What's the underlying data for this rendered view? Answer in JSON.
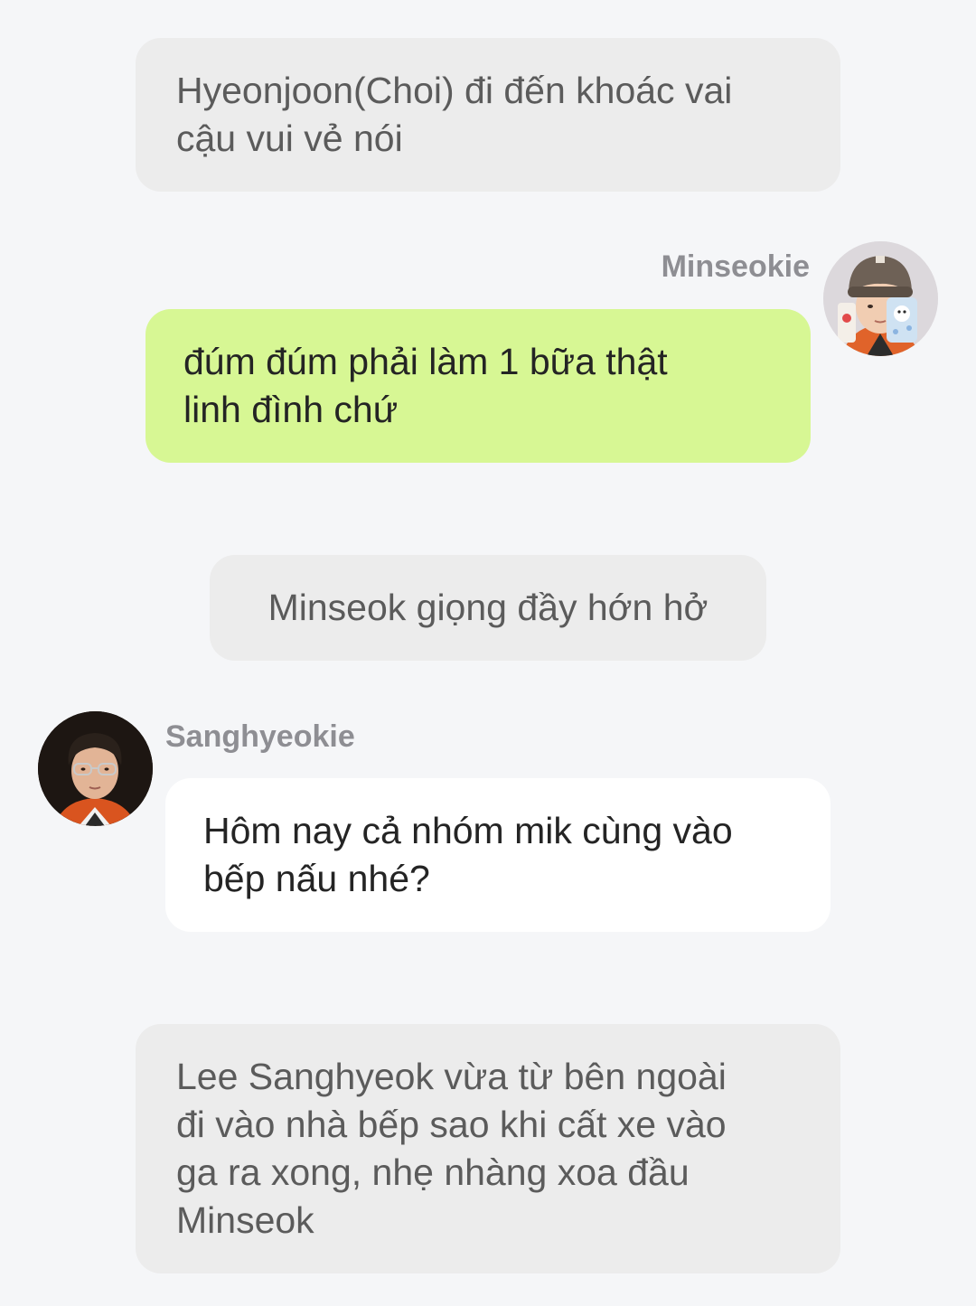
{
  "messages": [
    {
      "type": "narration",
      "text": "Hyeonjoon(Choi) đi đến khoác vai\ncậu vui vẻ nói"
    },
    {
      "type": "outgoing",
      "sender": "Minseokie",
      "avatar_icon": "boy-beanie-avatar-icon",
      "text": "đúm đúm phải làm 1 bữa thật\nlinh đình chứ",
      "bubble_color": "#d7f794"
    },
    {
      "type": "narration",
      "text": "Minseok giọng đầy hớn hở"
    },
    {
      "type": "incoming",
      "sender": "Sanghyeokie",
      "avatar_icon": "man-glasses-avatar-icon",
      "text": "Hôm nay cả nhóm mik cùng vào\nbếp nấu nhé?",
      "bubble_color": "#ffffff"
    },
    {
      "type": "narration",
      "text": "Lee Sanghyeok vừa từ bên ngoài\nđi vào nhà bếp sao khi cất xe vào\nga ra xong, nhẹ nhàng xoa đầu\nMinseok"
    }
  ],
  "colors": {
    "background": "#f5f6f8",
    "narration_bubble": "#ececec",
    "sender_name": "#8e8e93"
  }
}
